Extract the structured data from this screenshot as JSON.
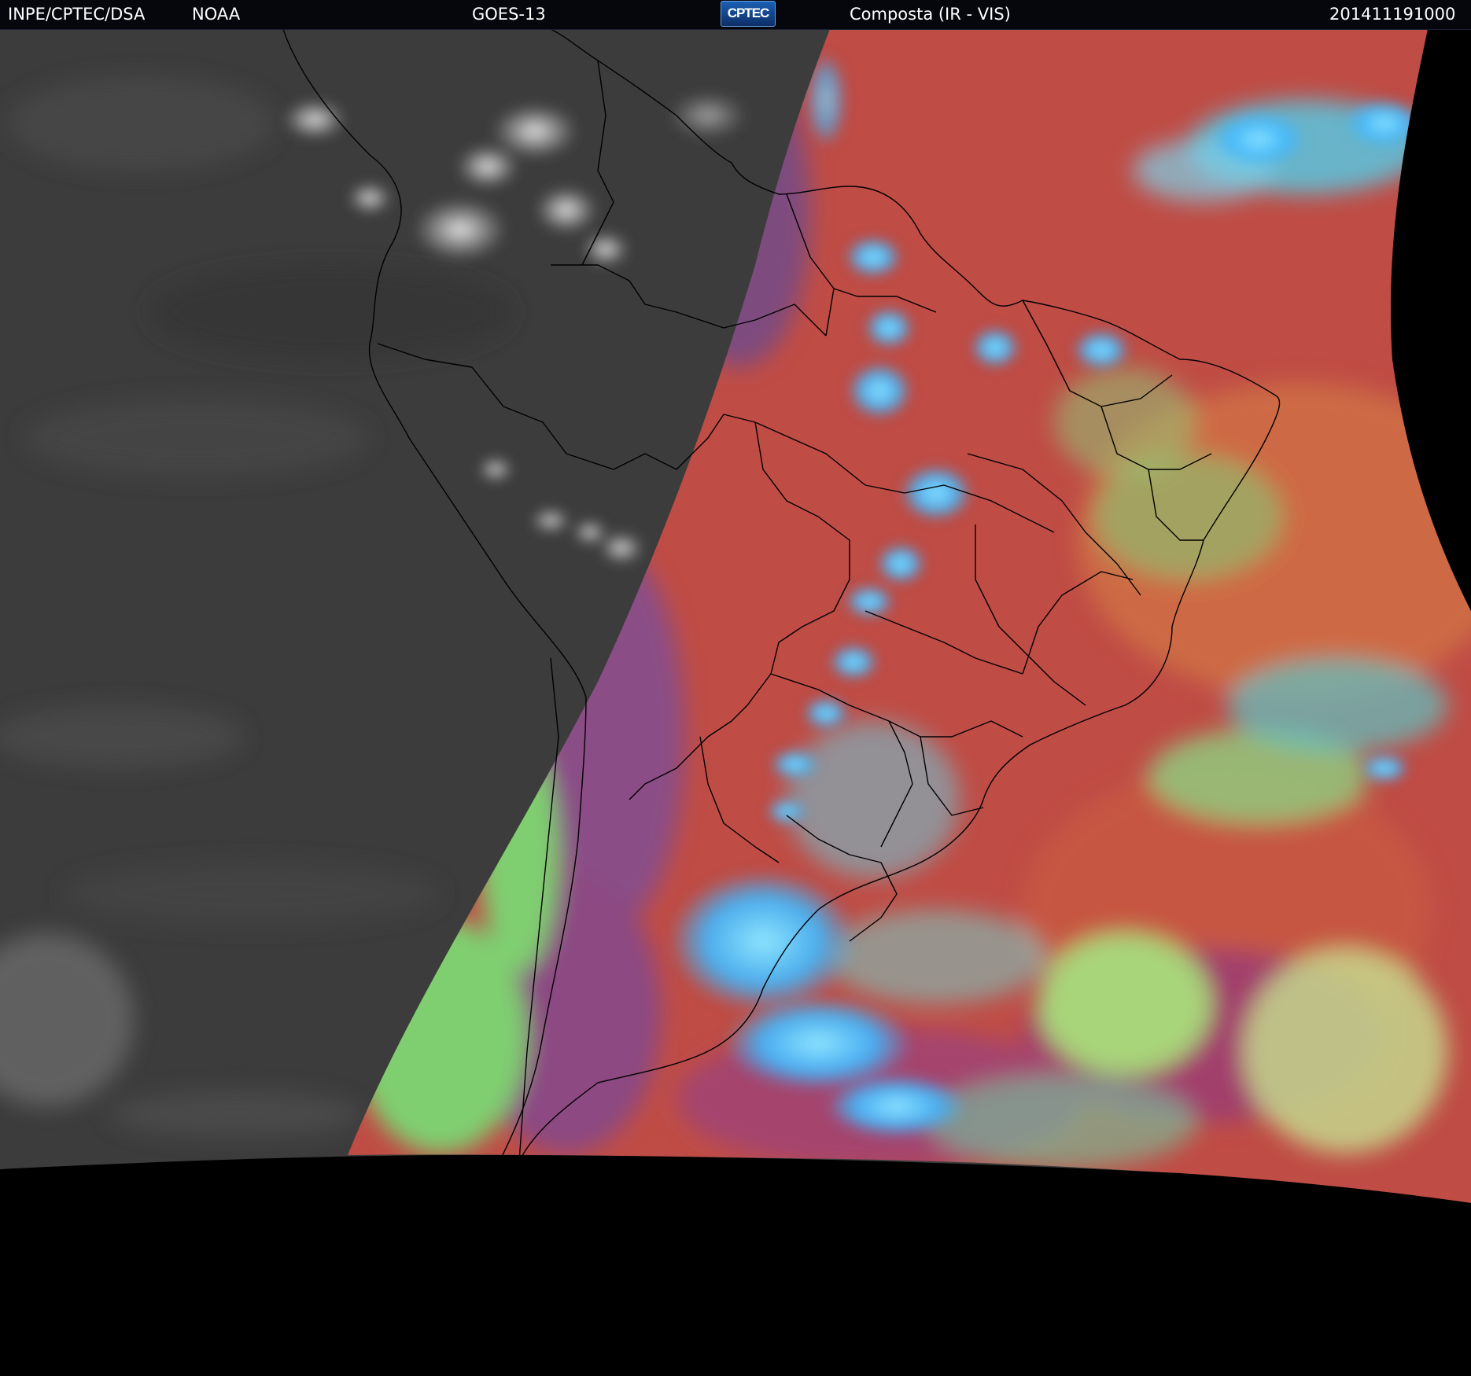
{
  "header": {
    "institution": "INPE/CPTEC/DSA",
    "agency": "NOAA",
    "satellite": "GOES-13",
    "logo_text": "CPTEC",
    "product": "Composta (IR - VIS)",
    "timestamp": "201411191000"
  },
  "map": {
    "region": "South America",
    "projection_edge_color": "#000000",
    "colors": {
      "night_ir_gray": "#3e3e3e",
      "land_red": "#b84a46",
      "ocean_orange": "#c9583f",
      "high_cloud_cyan": "#3fc6ff",
      "low_cloud_green": "#8be07a",
      "purple": "#7a4a8c",
      "magenta": "#9a3f6a",
      "borders": "#000000"
    }
  }
}
